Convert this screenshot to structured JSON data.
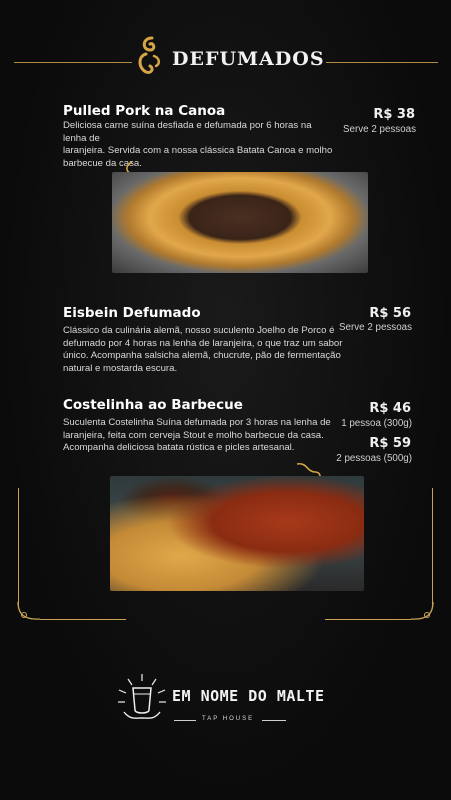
{
  "header": {
    "title": "DEFUMADOS",
    "ornament_icon": "gold-flourish-icon"
  },
  "items": [
    {
      "name": "Pulled Pork na Canoa",
      "description": [
        "Deliciosa carne suína desfiada e defumada por 6 horas na lenha de",
        "laranjeira. Servida com a nossa clássica Batata Canoa e molho",
        "barbecue da casa."
      ],
      "price": "R$ 38",
      "serve": "Serve 2 pessoas"
    },
    {
      "name": "Eisbein Defumado",
      "description": [
        "Clássico da culinária alemã, nosso suculento Joelho de Porco é",
        "defumado por 4 horas na lenha de laranjeira, o que traz um sabor",
        "único. Acompanha salsicha alemã, chucrute, pão de fermentação",
        "natural e mostarda escura."
      ],
      "price": "R$ 56",
      "serve": "Serve 2 pessoas"
    },
    {
      "name": "Costelinha ao Barbecue",
      "description": [
        "Suculenta Costelinha Suína defumada por 3 horas na lenha de",
        "laranjeira, feita com cerveja Stout e molho barbecue da casa.",
        "Acompanha deliciosa batata rústica e picles artesanal."
      ],
      "prices": [
        {
          "price": "R$ 46",
          "serve": "1 pessoa (300g)"
        },
        {
          "price": "R$ 59",
          "serve": "2 pessoas (500g)"
        }
      ]
    }
  ],
  "logo": {
    "name": "EM NOME DO MALTE",
    "sub": "TAP HOUSE",
    "icon": "beer-glass-sunburst-icon"
  },
  "colors": {
    "background": "#0d0d0d",
    "accent_gold": "#c9a256",
    "text": "#ffffff"
  }
}
